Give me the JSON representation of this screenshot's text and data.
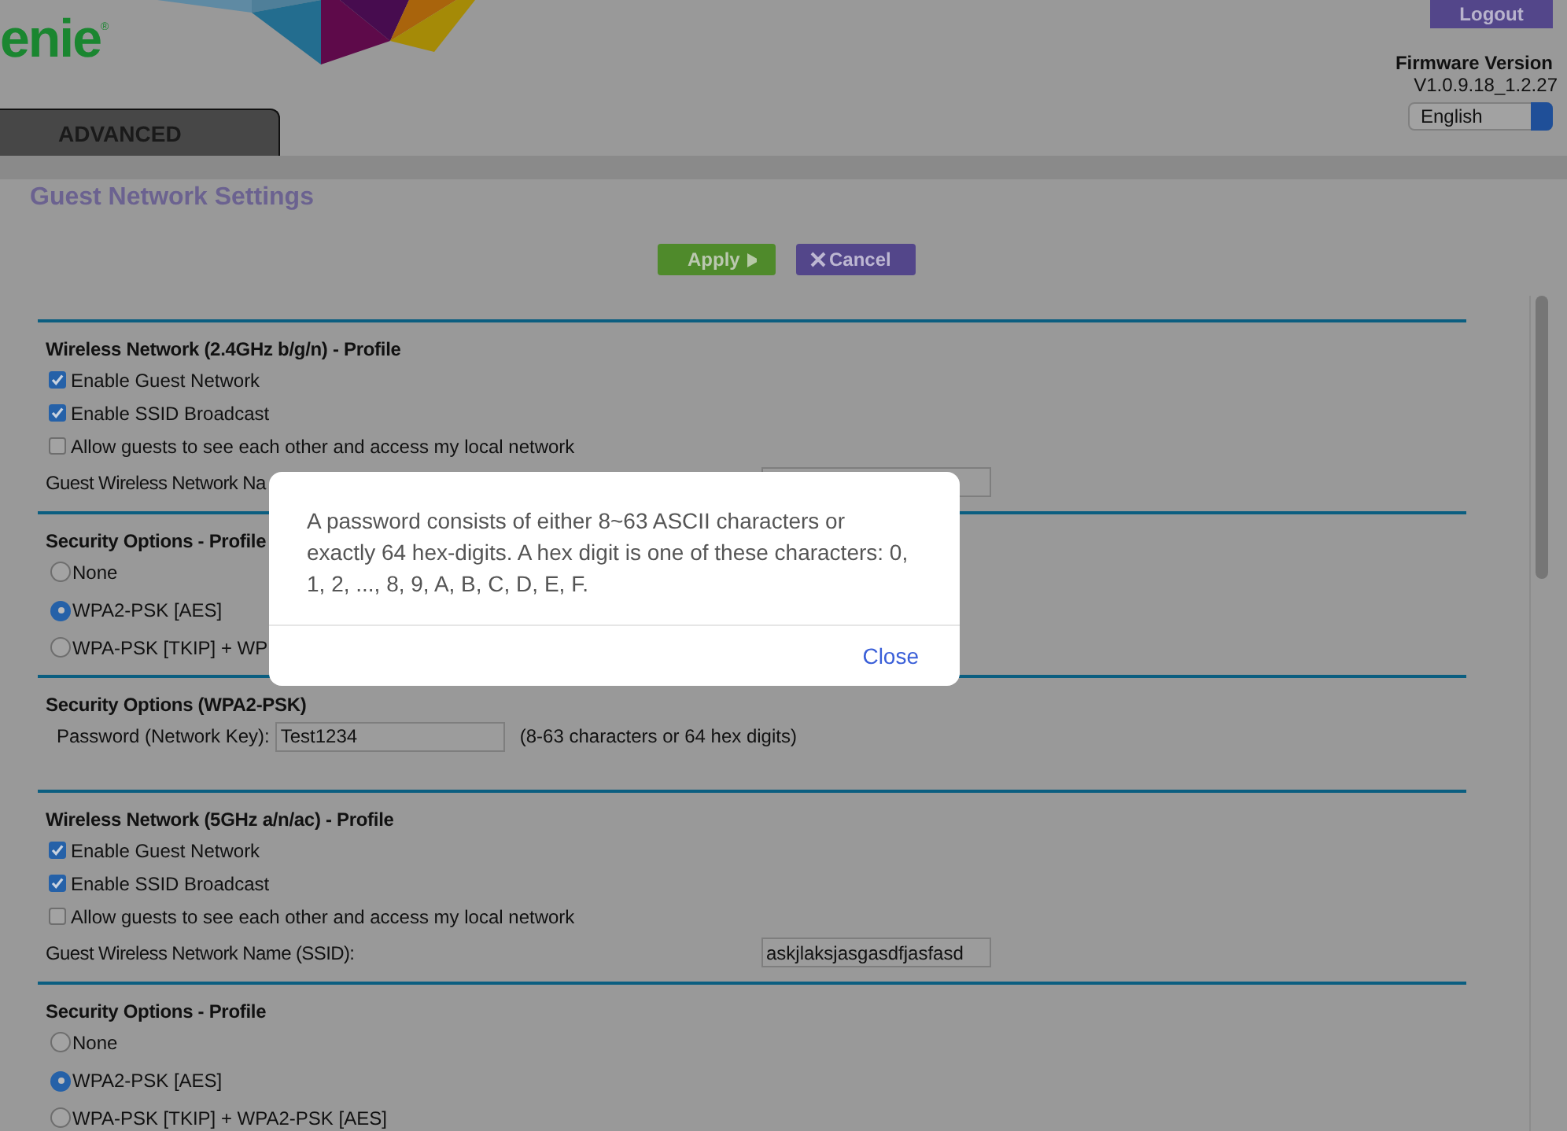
{
  "header": {
    "logo_text": "enie",
    "logo_mark": "®",
    "logout": "Logout",
    "firmware_label": "Firmware Version",
    "firmware_version": "V1.0.9.18_1.2.27",
    "language": "English",
    "tab": "ADVANCED"
  },
  "page_title": "Guest Network Settings",
  "buttons": [
    {
      "kind": "apply",
      "label": "Apply"
    },
    {
      "kind": "cancel",
      "label": "Cancel"
    }
  ],
  "sections": [
    {
      "title": "Wireless Network (2.4GHz b/g/n) - Profile",
      "rows": [
        {
          "kind": "checkbox",
          "label": "Enable Guest Network",
          "checked": true
        },
        {
          "kind": "checkbox",
          "label": "Enable SSID Broadcast",
          "checked": true
        },
        {
          "kind": "checkbox",
          "label": "Allow guests to see each other and access my local network",
          "checked": false
        },
        {
          "kind": "text_field",
          "label": "Guest Wireless Network Na"
        }
      ]
    },
    {
      "title": "Security Options - Profile",
      "rows": [
        {
          "kind": "radio",
          "label": "None",
          "selected": false
        },
        {
          "kind": "radio",
          "label": "WPA2-PSK [AES]",
          "selected": true
        },
        {
          "kind": "radio",
          "label": "WPA-PSK [TKIP] + WP",
          "selected": false
        }
      ]
    },
    {
      "title": "Security Options (WPA2-PSK)",
      "rows": [
        {
          "kind": "password",
          "label": "Password (Network Key):",
          "value": "Test1234",
          "hint": "(8-63 characters or 64 hex digits)"
        }
      ]
    },
    {
      "title": "Wireless Network (5GHz a/n/ac) - Profile",
      "rows": [
        {
          "kind": "checkbox",
          "label": "Enable Guest Network",
          "checked": true
        },
        {
          "kind": "checkbox",
          "label": "Enable SSID Broadcast",
          "checked": true
        },
        {
          "kind": "checkbox",
          "label": "Allow guests to see each other and access my local network",
          "checked": false
        },
        {
          "kind": "text_field",
          "label": "Guest Wireless Network Name (SSID):",
          "value": "askjlaksjasgasdfjasfasd"
        }
      ]
    },
    {
      "title": "Security Options - Profile",
      "rows": [
        {
          "kind": "radio",
          "label": "None",
          "selected": false
        },
        {
          "kind": "radio",
          "label": "WPA2-PSK [AES]",
          "selected": true
        },
        {
          "kind": "radio",
          "label": "WPA-PSK [TKIP] + WPA2-PSK [AES]",
          "selected": false
        }
      ]
    }
  ],
  "dialog": {
    "message": "A password consists of either 8~63 ASCII characters or exactly 64 hex-digits. A hex digit is one of these characters: 0, 1, 2, ..., 8, 9, A, B, C, D, E, F.",
    "close": "Close"
  }
}
